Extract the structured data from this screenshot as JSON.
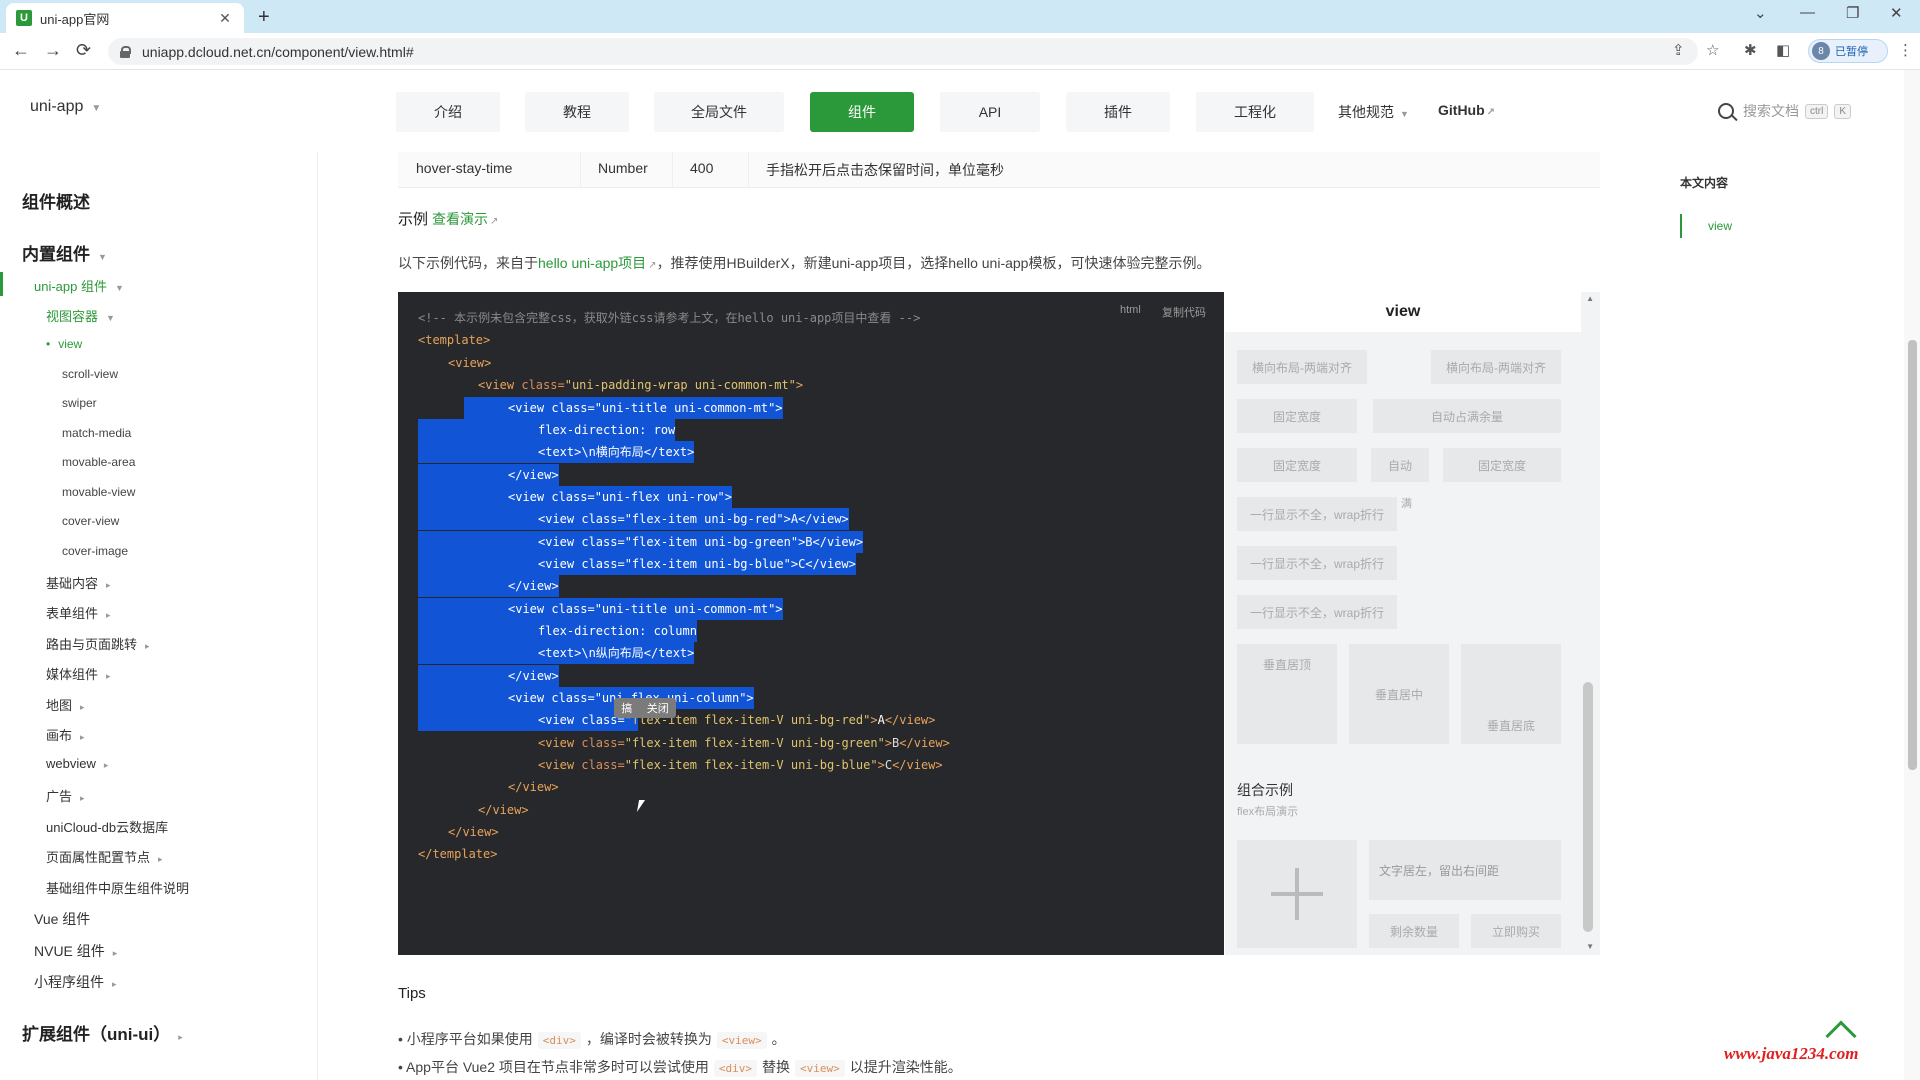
{
  "browser": {
    "tab_title": "uni-app官网",
    "tab_favicon": "U",
    "new_tab": "+",
    "url": "uniapp.dcloud.net.cn/component/view.html#",
    "profile_initial": "8",
    "profile_label": "已暂停",
    "window_controls": {
      "chevron": "⌄",
      "minimize": "—",
      "restore": "❐",
      "close": "✕"
    },
    "nav": {
      "back": "←",
      "forward": "→",
      "reload": "⟳"
    }
  },
  "header": {
    "brand": "uni-app",
    "nav_items": [
      "介绍",
      "教程",
      "全局文件",
      "组件",
      "API",
      "插件",
      "工程化"
    ],
    "active_nav": "组件",
    "more": "其他规范",
    "github": "GitHub",
    "search_placeholder": "搜索文档",
    "kbd_ctrl": "ctrl",
    "kbd_k": "K"
  },
  "sidebar": {
    "overview": "组件概述",
    "builtin": "内置组件",
    "uniapp_components": "uni-app 组件",
    "view_container": "视图容器",
    "items": [
      "view",
      "scroll-view",
      "swiper",
      "match-media",
      "movable-area",
      "movable-view",
      "cover-view",
      "cover-image"
    ],
    "groups": [
      "基础内容",
      "表单组件",
      "路由与页面跳转",
      "媒体组件",
      "地图",
      "画布",
      "webview",
      "广告",
      "uniCloud-db云数据库",
      "页面属性配置节点",
      "基础组件中原生组件说明"
    ],
    "vue": "Vue 组件",
    "nvue": "NVUE 组件",
    "mini": "小程序组件",
    "ext": "扩展组件（uni-ui）"
  },
  "main": {
    "prop_row": {
      "name": "hover-stay-time",
      "type": "Number",
      "default": "400",
      "desc": "手指松开后点击态保留时间，单位毫秒"
    },
    "example_title": "示例",
    "example_link": "查看演示",
    "desc_pre": "以下示例代码，来自于",
    "desc_link": "hello uni-app项目",
    "desc_post": "，推荐使用HBuilderX，新建uni-app项目，选择hello uni-app模板，可快速体验完整示例。",
    "code_lang": "html",
    "code_copy": "复制代码",
    "code_comment": "<!-- 本示例未包含完整css，获取外链css请参考上文，在hello uni-app项目中查看 -->",
    "tooltip": [
      "搞",
      "关闭"
    ],
    "tips_title": "Tips",
    "tips": [
      {
        "pre": "小程序平台如果使用",
        "code1": "<div>",
        "mid": "，编译时会被转换为",
        "code2": "<view>",
        "post": "。"
      },
      {
        "pre": "App平台 Vue2 项目在节点非常多时可以尝试使用",
        "code1": "<div>",
        "mid": "替换",
        "code2": "<view>",
        "post": "以提升渲染性能。"
      }
    ]
  },
  "preview": {
    "title": "view",
    "row1": [
      "横向布局-两端对齐",
      "横向布局-两端对齐"
    ],
    "row2": [
      "固定宽度",
      "自动占满余量"
    ],
    "row3": [
      "固定宽度",
      "自动",
      "固定宽度"
    ],
    "wrap": "一行显示不全，wrap折行",
    "wrap_extra": "满",
    "vert": [
      "垂直居顶",
      "垂直居中",
      "垂直居底"
    ],
    "combo_title": "组合示例",
    "combo_sub": "flex布局演示",
    "combo_text": "文字居左，留出右间距",
    "buttons": [
      "剩余数量",
      "立即购买"
    ]
  },
  "toc": {
    "title": "本文内容",
    "item": "view"
  },
  "watermark": "www.java1234.com"
}
